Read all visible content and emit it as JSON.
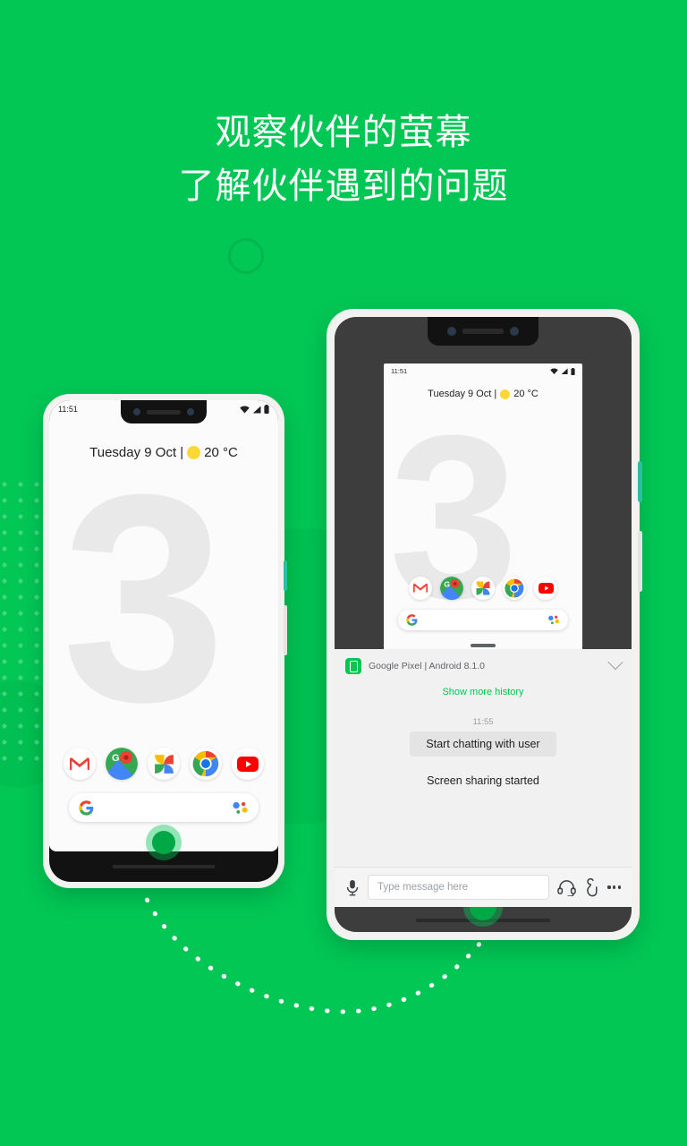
{
  "theme": {
    "background_green": "#02c755",
    "accent_green": "#00c853",
    "dark_screen": "#3d3d3d",
    "text_dark": "#202124",
    "text_muted": "#5f6368"
  },
  "headline": {
    "line1": "观察伙伴的萤幕",
    "line2": "了解伙伴遇到的问题"
  },
  "phone_left": {
    "status_time": "11:51",
    "status_icons": [
      "wifi-icon",
      "signal-icon",
      "battery-icon"
    ],
    "date_widget": "Tuesday 9 Oct |",
    "weather": "20 °C",
    "wallpaper_text": "3",
    "dock_apps": [
      {
        "name": "gmail",
        "label": "Gmail"
      },
      {
        "name": "maps",
        "label": "Maps"
      },
      {
        "name": "photos",
        "label": "Photos"
      },
      {
        "name": "chrome",
        "label": "Chrome"
      },
      {
        "name": "youtube",
        "label": "YouTube"
      }
    ],
    "search_placeholder": ""
  },
  "phone_right": {
    "status_time": "11:51",
    "date_widget": "Tuesday 9 Oct |",
    "weather": "20 °C",
    "wallpaper_text": "3",
    "dock_apps": [
      {
        "name": "gmail",
        "label": "Gmail"
      },
      {
        "name": "maps",
        "label": "Maps"
      },
      {
        "name": "photos",
        "label": "Photos"
      },
      {
        "name": "chrome",
        "label": "Chrome"
      },
      {
        "name": "youtube",
        "label": "YouTube"
      }
    ]
  },
  "chat_panel": {
    "device_label": "Google Pixel | Android 8.1.0",
    "collapse_icon": "chevron-down-icon",
    "show_more": "Show more history",
    "timestamp": "11:55",
    "bubble_text": "Start chatting with user",
    "system_message": "Screen sharing started",
    "toolbar": {
      "mic_icon": "microphone-icon",
      "input_placeholder": "Type message here",
      "input_value": "",
      "headset_icon": "headset-icon",
      "gesture_icon": "hand-gesture-icon",
      "overflow_icon": "more-options-icon"
    }
  }
}
